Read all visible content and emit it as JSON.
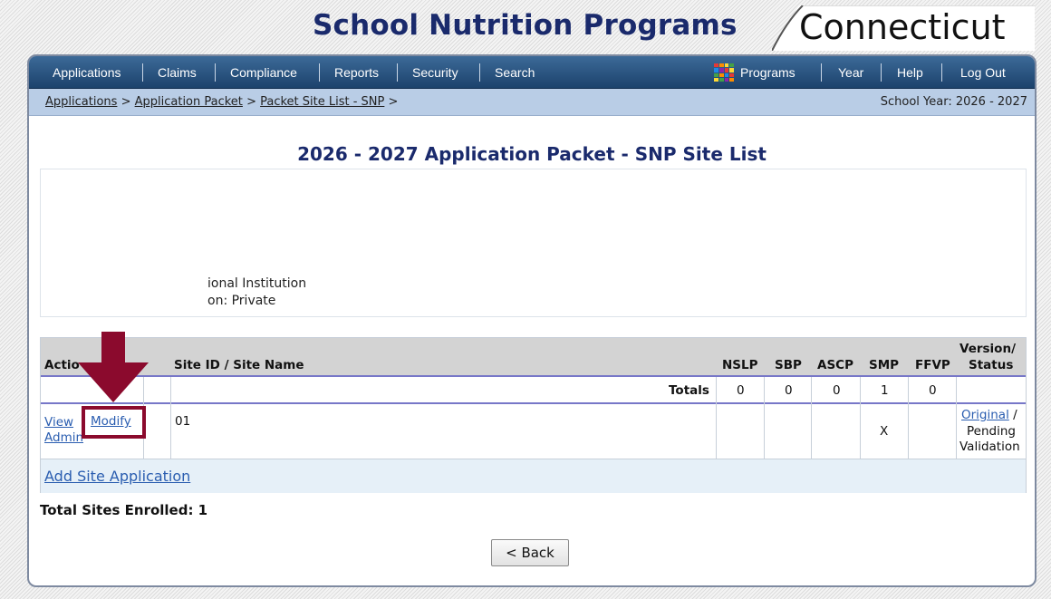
{
  "banner": {
    "title": "School Nutrition Programs",
    "state": "Connecticut"
  },
  "nav": {
    "items": [
      "Applications",
      "Claims",
      "Compliance",
      "Reports",
      "Security",
      "Search"
    ],
    "right_items": [
      "Programs",
      "Year",
      "Help",
      "Log Out"
    ]
  },
  "breadcrumb": {
    "items": [
      "Applications",
      "Application Packet",
      "Packet Site List - SNP"
    ],
    "separator": ">",
    "school_year": "School Year: 2026 - 2027"
  },
  "page": {
    "title": "2026 - 2027 Application Packet - SNP Site List"
  },
  "info": {
    "line1": "ional Institution",
    "line2": "on: Private"
  },
  "table": {
    "headers": {
      "action": "Actio",
      "site": "Site ID / Site Name",
      "nslp": "NSLP",
      "sbp": "SBP",
      "ascp": "ASCP",
      "smp": "SMP",
      "ffvp": "FFVP",
      "version_line1": "Version/",
      "version_line2": "Status"
    },
    "totals": {
      "label": "Totals",
      "nslp": "0",
      "sbp": "0",
      "ascp": "0",
      "smp": "1",
      "ffvp": "0"
    },
    "rows": [
      {
        "view": "View",
        "admin": "Admin",
        "modify": "Modify",
        "site_id": "01",
        "nslp": "",
        "sbp": "",
        "ascp": "",
        "smp": "X",
        "ffvp": "",
        "version_link": "Original",
        "version_sep": "/",
        "status_line1": "Pending",
        "status_line2": "Validation"
      }
    ],
    "add_link": "Add Site Application"
  },
  "summary": {
    "total_sites": "Total Sites Enrolled: 1"
  },
  "buttons": {
    "back": "< Back"
  },
  "colors": {
    "brand_navy": "#1a2a6c",
    "nav_blue": "#1c426c",
    "crumb_bg": "#b9cde6",
    "annotation_red": "#8b0a2d",
    "link_blue": "#2a5db0"
  }
}
